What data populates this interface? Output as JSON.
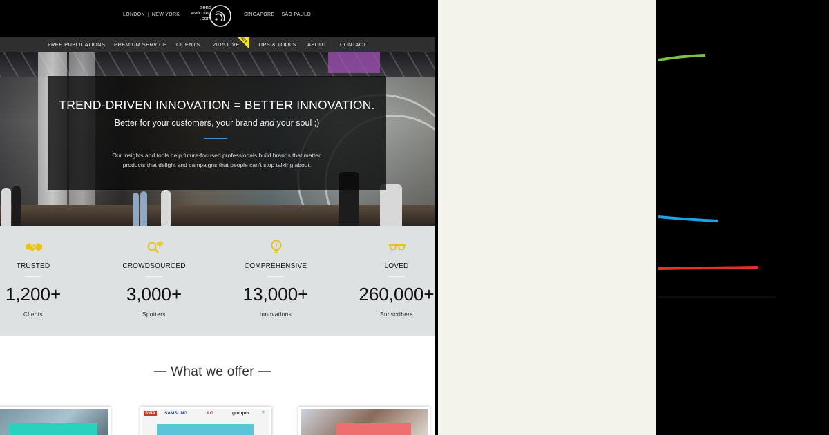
{
  "header": {
    "cities_left": [
      "LONDON",
      "NEW YORK"
    ],
    "cities_right": [
      "SINGAPORE",
      "SÃO PAULO"
    ],
    "logo_lines": [
      "trend",
      "watching",
      ".com"
    ]
  },
  "nav": {
    "items": [
      "FREE PUBLICATIONS",
      "PREMIUM SERVICE",
      "CLIENTS",
      "2015 LIVE",
      "TIPS & TOOLS",
      "ABOUT",
      "CONTACT"
    ],
    "new_flag": "NEW"
  },
  "hero": {
    "title": "TREND-DRIVEN INNOVATION = BETTER INNOVATION.",
    "subtitle_before": "Better for your customers, your brand ",
    "subtitle_em": "and",
    "subtitle_after": " your soul ;)",
    "description_line1": "Our insights and tools help future-focused professionals build brands that matter,",
    "description_line2": "products that delight and campaigns that people can't stop talking about."
  },
  "stats": [
    {
      "icon": "handshake-icon",
      "label": "TRUSTED",
      "value": "1,200+",
      "unit": "Clients"
    },
    {
      "icon": "search-eye-icon",
      "label": "CROWDSOURCED",
      "value": "3,000+",
      "unit": "Spotters"
    },
    {
      "icon": "lightbulb-icon",
      "label": "COMPREHENSIVE",
      "value": "13,000+",
      "unit": "Innovations"
    },
    {
      "icon": "glasses-icon",
      "label": "LOVED",
      "value": "260,000+",
      "unit": "Subscribers"
    }
  ],
  "offer": {
    "title": "What we offer",
    "card2_logos": [
      "SWA",
      "SAMSUNG",
      "LG",
      "groupm",
      "Z"
    ]
  },
  "colors": {
    "accent_yellow": "#e8c31c",
    "nav_bg": "#2f2f2f",
    "stats_bg": "#dee1e1",
    "cream_bg": "#f3f3eb",
    "arc_green": "#7dc142",
    "arc_blue": "#1aa3e8",
    "arc_red": "#e8302a"
  }
}
